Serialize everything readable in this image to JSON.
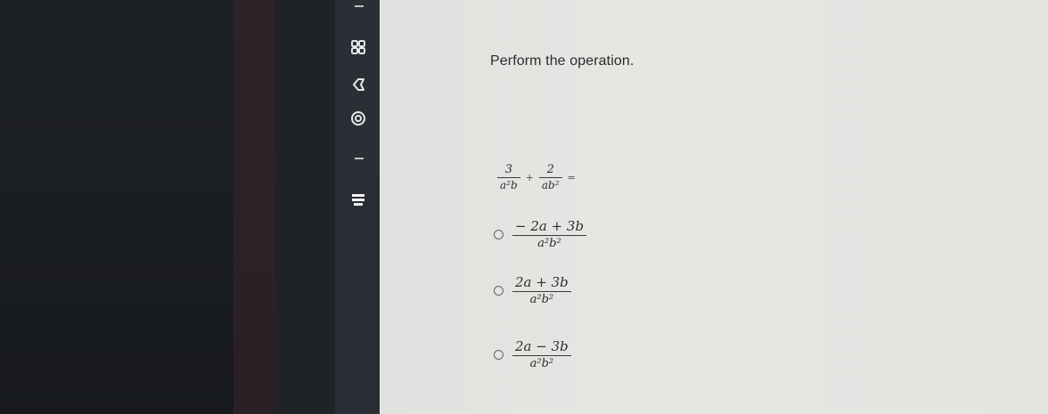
{
  "question": {
    "prompt": "Perform the operation."
  },
  "problem": {
    "term1": {
      "num": "3",
      "den": "a²b"
    },
    "operator": "+",
    "term2": {
      "num": "2",
      "den": "ab²"
    },
    "equals": "="
  },
  "choices": [
    {
      "num": "− 2a + 3b",
      "den": "a²b²"
    },
    {
      "num": "2a + 3b",
      "den": "a²b²"
    },
    {
      "num": "2a − 3b",
      "den": "a²b²"
    }
  ],
  "sidebar": {
    "icons": [
      "grid-icon",
      "back-arrow-icon",
      "settings-icon",
      "menu-icon"
    ]
  }
}
